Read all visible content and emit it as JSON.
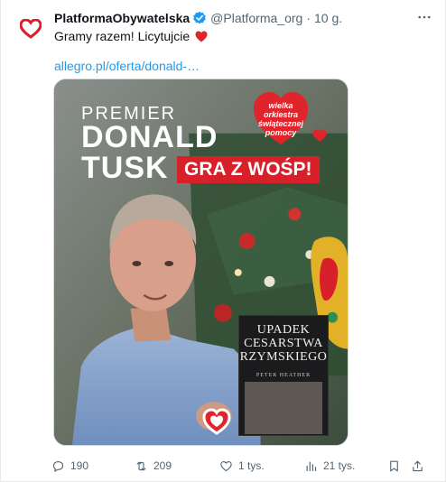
{
  "tweet": {
    "display_name": "PlatformaObywatelska",
    "handle": "@Platforma_org",
    "separator": "·",
    "time": "10 g.",
    "more_label": "···",
    "text": "Gramy razem! Licytujcie",
    "link": "allegro.pl/oferta/donald-…"
  },
  "media": {
    "premier": "PREMIER",
    "donald": "DONALD",
    "tusk": "TUSK",
    "gra": "GRA Z WOŚP!",
    "wosp_line1": "wielka orkiestra",
    "wosp_line2": "świątecznej",
    "wosp_line3": "pomocy",
    "book_line1": "UPADEK",
    "book_line2": "CESARSTWA",
    "book_line3": "RZYMSKIEGO",
    "book_author": "PETER HEATHER"
  },
  "actions": {
    "replies": "190",
    "reposts": "209",
    "likes": "1 tys.",
    "views": "21 tys."
  },
  "colors": {
    "accent": "#1d9bf0",
    "wosp_red": "#d8202b",
    "muted": "#536471"
  },
  "icons": [
    "heart-logo-icon",
    "verified-badge-icon",
    "more-icon",
    "red-heart-emoji-icon",
    "reply-icon",
    "retweet-icon",
    "like-icon",
    "views-icon",
    "bookmark-icon",
    "share-icon"
  ]
}
